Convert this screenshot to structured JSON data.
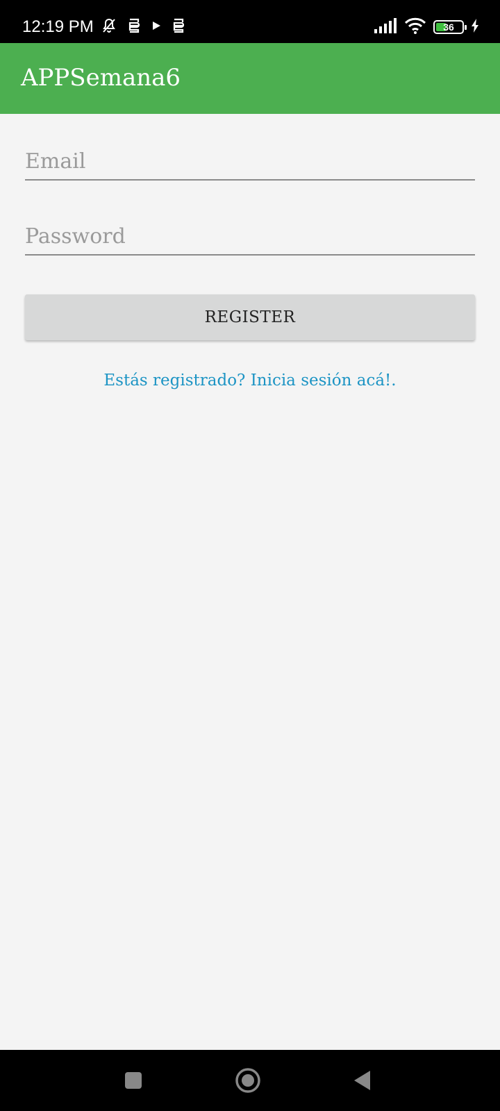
{
  "status_bar": {
    "time": "12:19 PM",
    "battery_level": "36",
    "icons_left": [
      "muted-bell-icon",
      "s-app-icon",
      "play-icon",
      "s-app-icon"
    ],
    "icons_right": [
      "signal-icon",
      "wifi-icon",
      "battery-icon",
      "charging-icon"
    ]
  },
  "app_bar": {
    "title": "APPSemana6",
    "color": "#4caf50"
  },
  "form": {
    "email_placeholder": "Email",
    "email_value": "",
    "password_placeholder": "Password",
    "password_value": "",
    "register_label": "REGISTER",
    "login_link": "Estás registrado? Inicia sesión acá!."
  },
  "colors": {
    "link": "#1c94c4",
    "button": "#d7d8d8",
    "background": "#f4f4f4"
  },
  "nav_bar": {
    "buttons": [
      "recent-apps-icon",
      "home-icon",
      "back-icon"
    ]
  }
}
